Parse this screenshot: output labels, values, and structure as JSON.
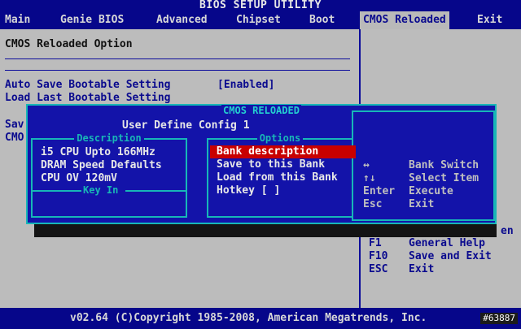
{
  "title": "BIOS SETUP UTILITY",
  "tabs": [
    {
      "label": "Main"
    },
    {
      "label": "Genie BIOS"
    },
    {
      "label": "Advanced"
    },
    {
      "label": "Chipset"
    },
    {
      "label": "Boot"
    },
    {
      "label": "CMOS Reloaded"
    },
    {
      "label": "Exit"
    }
  ],
  "left": {
    "section_title": "CMOS Reloaded Option",
    "auto_save_label": "Auto Save Bootable Setting",
    "auto_save_value": "[Enabled]",
    "load_last_label": "Load Last Bootable Setting",
    "partial_1": "Sav",
    "partial_2": "CMO"
  },
  "dialog": {
    "title": "CMOS RELOADED",
    "subtitle": "User Define Config 1",
    "description_title": "Description",
    "description_lines": [
      "i5 CPU Upto 166MHz",
      "DRAM Speed Defaults",
      "CPU OV 120mV"
    ],
    "keyin_title": "Key In",
    "options_title": "Options",
    "options": [
      "Bank description",
      "Save to this Bank",
      "Load from this Bank",
      "Hotkey  [ ]"
    ],
    "help": [
      {
        "key": "↔",
        "desc": "Bank Switch"
      },
      {
        "key": "↑↓",
        "desc": "Select Item"
      },
      {
        "key": "Enter",
        "desc": "Execute"
      },
      {
        "key": "Esc",
        "desc": "Exit"
      }
    ]
  },
  "right_help": {
    "partial": "en",
    "items": [
      {
        "key": "F1",
        "desc": "General Help"
      },
      {
        "key": "F10",
        "desc": "Save and Exit"
      },
      {
        "key": "ESC",
        "desc": "Exit"
      }
    ]
  },
  "footer": {
    "copyright": "v02.64 (C)Copyright 1985-2008, American Megatrends, Inc.",
    "watermark": "#63887"
  },
  "colors": {
    "bios_blue": "#06068a",
    "panel_grey": "#bcbcbc",
    "dialog_blue": "#1313a9",
    "frame_cyan": "#17b7b7",
    "selection_red": "#c80000"
  }
}
